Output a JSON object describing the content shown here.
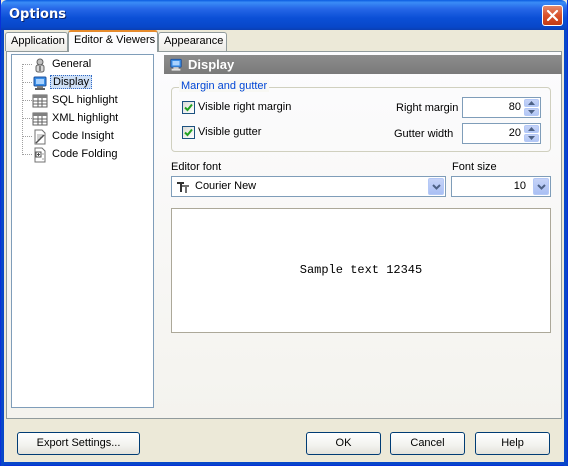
{
  "window": {
    "title": "Options"
  },
  "tabs": [
    {
      "label": "Application"
    },
    {
      "label": "Editor & Viewers"
    },
    {
      "label": "Appearance"
    }
  ],
  "tree": {
    "items": [
      {
        "label": "General",
        "icon": "general-icon"
      },
      {
        "label": "Display",
        "icon": "display-icon",
        "selected": true
      },
      {
        "label": "SQL highlight",
        "icon": "grid-icon"
      },
      {
        "label": "XML highlight",
        "icon": "grid-icon"
      },
      {
        "label": "Code Insight",
        "icon": "code-insight-icon"
      },
      {
        "label": "Code Folding",
        "icon": "code-folding-icon"
      }
    ]
  },
  "panel": {
    "title": "Display",
    "group_caption": "Margin and gutter",
    "visible_right_margin": {
      "label": "Visible right margin",
      "checked": true
    },
    "visible_gutter": {
      "label": "Visible gutter",
      "checked": true
    },
    "right_margin": {
      "label": "Right margin",
      "value": "80"
    },
    "gutter_width": {
      "label": "Gutter width",
      "value": "20"
    },
    "editor_font": {
      "label": "Editor font",
      "value": "Courier New"
    },
    "font_size": {
      "label": "Font size",
      "value": "10"
    },
    "preview_text": "Sample text 12345"
  },
  "buttons": {
    "export": "Export Settings...",
    "ok": "OK",
    "cancel": "Cancel",
    "help": "Help"
  },
  "colors": {
    "titlebar": "#0a4fd6",
    "group_caption": "#0046d5",
    "panel_header": "#808080",
    "selection": "#cfe0f6"
  }
}
